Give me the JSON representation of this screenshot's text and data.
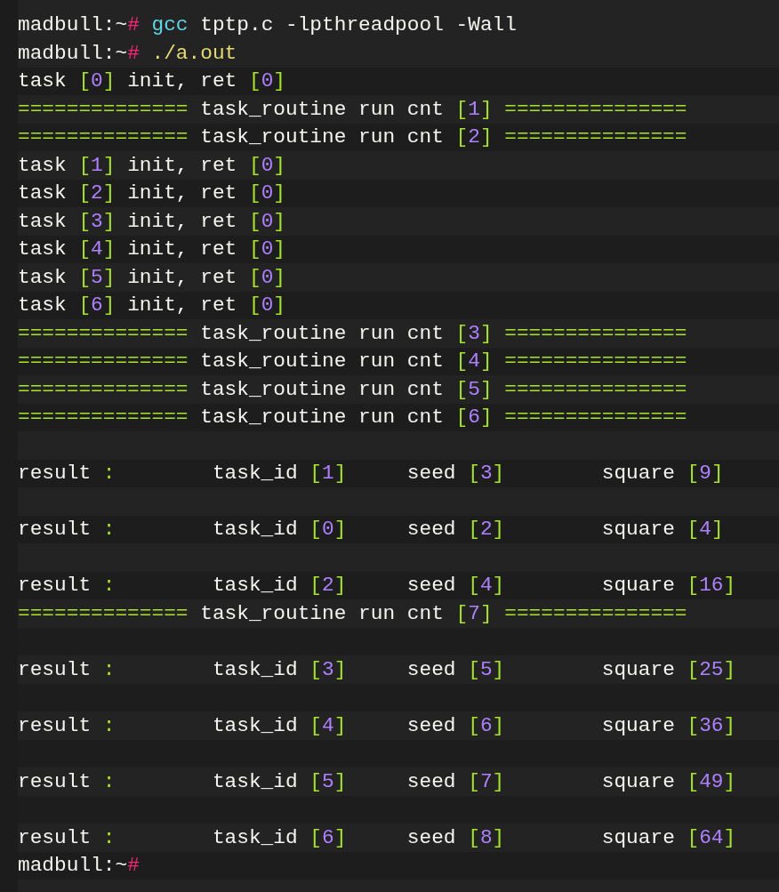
{
  "lines": [
    {
      "kind": "text",
      "segments": [
        {
          "kind": "plain",
          "text": "madbull:~"
        },
        {
          "kind": "prompt",
          "text": "# "
        },
        {
          "kind": "command",
          "text": "gcc"
        },
        {
          "kind": "plain",
          "text": " tptp.c -lpthreadpool -Wall"
        }
      ]
    },
    {
      "kind": "text",
      "segments": [
        {
          "kind": "plain",
          "text": "madbull:~"
        },
        {
          "kind": "prompt",
          "text": "# "
        },
        {
          "kind": "path",
          "text": "./a.out"
        }
      ]
    },
    {
      "kind": "text",
      "segments": [
        {
          "kind": "plain",
          "text": "task "
        },
        {
          "kind": "bracket",
          "text": "["
        },
        {
          "kind": "number",
          "text": "0"
        },
        {
          "kind": "bracket",
          "text": "]"
        },
        {
          "kind": "plain",
          "text": " init, ret "
        },
        {
          "kind": "bracket",
          "text": "["
        },
        {
          "kind": "number",
          "text": "0"
        },
        {
          "kind": "bracket",
          "text": "]"
        }
      ]
    },
    {
      "kind": "text",
      "segments": [
        {
          "kind": "rule",
          "text": "=============="
        },
        {
          "kind": "plain",
          "text": " task_routine run cnt "
        },
        {
          "kind": "bracket",
          "text": "["
        },
        {
          "kind": "number",
          "text": "1"
        },
        {
          "kind": "bracket",
          "text": "]"
        },
        {
          "kind": "rule",
          "text": " ==============="
        }
      ]
    },
    {
      "kind": "text",
      "segments": [
        {
          "kind": "rule",
          "text": "=============="
        },
        {
          "kind": "plain",
          "text": " task_routine run cnt "
        },
        {
          "kind": "bracket",
          "text": "["
        },
        {
          "kind": "number",
          "text": "2"
        },
        {
          "kind": "bracket",
          "text": "]"
        },
        {
          "kind": "rule",
          "text": " ==============="
        }
      ]
    },
    {
      "kind": "text",
      "segments": [
        {
          "kind": "plain",
          "text": "task "
        },
        {
          "kind": "bracket",
          "text": "["
        },
        {
          "kind": "number",
          "text": "1"
        },
        {
          "kind": "bracket",
          "text": "]"
        },
        {
          "kind": "plain",
          "text": " init, ret "
        },
        {
          "kind": "bracket",
          "text": "["
        },
        {
          "kind": "number",
          "text": "0"
        },
        {
          "kind": "bracket",
          "text": "]"
        }
      ]
    },
    {
      "kind": "text",
      "segments": [
        {
          "kind": "plain",
          "text": "task "
        },
        {
          "kind": "bracket",
          "text": "["
        },
        {
          "kind": "number",
          "text": "2"
        },
        {
          "kind": "bracket",
          "text": "]"
        },
        {
          "kind": "plain",
          "text": " init, ret "
        },
        {
          "kind": "bracket",
          "text": "["
        },
        {
          "kind": "number",
          "text": "0"
        },
        {
          "kind": "bracket",
          "text": "]"
        }
      ]
    },
    {
      "kind": "text",
      "segments": [
        {
          "kind": "plain",
          "text": "task "
        },
        {
          "kind": "bracket",
          "text": "["
        },
        {
          "kind": "number",
          "text": "3"
        },
        {
          "kind": "bracket",
          "text": "]"
        },
        {
          "kind": "plain",
          "text": " init, ret "
        },
        {
          "kind": "bracket",
          "text": "["
        },
        {
          "kind": "number",
          "text": "0"
        },
        {
          "kind": "bracket",
          "text": "]"
        }
      ]
    },
    {
      "kind": "text",
      "segments": [
        {
          "kind": "plain",
          "text": "task "
        },
        {
          "kind": "bracket",
          "text": "["
        },
        {
          "kind": "number",
          "text": "4"
        },
        {
          "kind": "bracket",
          "text": "]"
        },
        {
          "kind": "plain",
          "text": " init, ret "
        },
        {
          "kind": "bracket",
          "text": "["
        },
        {
          "kind": "number",
          "text": "0"
        },
        {
          "kind": "bracket",
          "text": "]"
        }
      ]
    },
    {
      "kind": "text",
      "segments": [
        {
          "kind": "plain",
          "text": "task "
        },
        {
          "kind": "bracket",
          "text": "["
        },
        {
          "kind": "number",
          "text": "5"
        },
        {
          "kind": "bracket",
          "text": "]"
        },
        {
          "kind": "plain",
          "text": " init, ret "
        },
        {
          "kind": "bracket",
          "text": "["
        },
        {
          "kind": "number",
          "text": "0"
        },
        {
          "kind": "bracket",
          "text": "]"
        }
      ]
    },
    {
      "kind": "text",
      "segments": [
        {
          "kind": "plain",
          "text": "task "
        },
        {
          "kind": "bracket",
          "text": "["
        },
        {
          "kind": "number",
          "text": "6"
        },
        {
          "kind": "bracket",
          "text": "]"
        },
        {
          "kind": "plain",
          "text": " init, ret "
        },
        {
          "kind": "bracket",
          "text": "["
        },
        {
          "kind": "number",
          "text": "0"
        },
        {
          "kind": "bracket",
          "text": "]"
        }
      ]
    },
    {
      "kind": "text",
      "segments": [
        {
          "kind": "rule",
          "text": "=============="
        },
        {
          "kind": "plain",
          "text": " task_routine run cnt "
        },
        {
          "kind": "bracket",
          "text": "["
        },
        {
          "kind": "number",
          "text": "3"
        },
        {
          "kind": "bracket",
          "text": "]"
        },
        {
          "kind": "rule",
          "text": " ==============="
        }
      ]
    },
    {
      "kind": "text",
      "segments": [
        {
          "kind": "rule",
          "text": "=============="
        },
        {
          "kind": "plain",
          "text": " task_routine run cnt "
        },
        {
          "kind": "bracket",
          "text": "["
        },
        {
          "kind": "number",
          "text": "4"
        },
        {
          "kind": "bracket",
          "text": "]"
        },
        {
          "kind": "rule",
          "text": " ==============="
        }
      ]
    },
    {
      "kind": "text",
      "segments": [
        {
          "kind": "rule",
          "text": "=============="
        },
        {
          "kind": "plain",
          "text": " task_routine run cnt "
        },
        {
          "kind": "bracket",
          "text": "["
        },
        {
          "kind": "number",
          "text": "5"
        },
        {
          "kind": "bracket",
          "text": "]"
        },
        {
          "kind": "rule",
          "text": " ==============="
        }
      ]
    },
    {
      "kind": "text",
      "segments": [
        {
          "kind": "rule",
          "text": "=============="
        },
        {
          "kind": "plain",
          "text": " task_routine run cnt "
        },
        {
          "kind": "bracket",
          "text": "["
        },
        {
          "kind": "number",
          "text": "6"
        },
        {
          "kind": "bracket",
          "text": "]"
        },
        {
          "kind": "rule",
          "text": " ==============="
        }
      ]
    },
    {
      "kind": "blank"
    },
    {
      "kind": "text",
      "segments": [
        {
          "kind": "plain",
          "text": "result "
        },
        {
          "kind": "colon",
          "text": ":"
        },
        {
          "kind": "plain",
          "text": "        task_id "
        },
        {
          "kind": "bracket",
          "text": "["
        },
        {
          "kind": "number",
          "text": "1"
        },
        {
          "kind": "bracket",
          "text": "]"
        },
        {
          "kind": "plain",
          "text": "     seed "
        },
        {
          "kind": "bracket",
          "text": "["
        },
        {
          "kind": "number",
          "text": "3"
        },
        {
          "kind": "bracket",
          "text": "]"
        },
        {
          "kind": "plain",
          "text": "        square "
        },
        {
          "kind": "bracket",
          "text": "["
        },
        {
          "kind": "number",
          "text": "9"
        },
        {
          "kind": "bracket",
          "text": "]"
        }
      ]
    },
    {
      "kind": "blank"
    },
    {
      "kind": "text",
      "segments": [
        {
          "kind": "plain",
          "text": "result "
        },
        {
          "kind": "colon",
          "text": ":"
        },
        {
          "kind": "plain",
          "text": "        task_id "
        },
        {
          "kind": "bracket",
          "text": "["
        },
        {
          "kind": "number",
          "text": "0"
        },
        {
          "kind": "bracket",
          "text": "]"
        },
        {
          "kind": "plain",
          "text": "     seed "
        },
        {
          "kind": "bracket",
          "text": "["
        },
        {
          "kind": "number",
          "text": "2"
        },
        {
          "kind": "bracket",
          "text": "]"
        },
        {
          "kind": "plain",
          "text": "        square "
        },
        {
          "kind": "bracket",
          "text": "["
        },
        {
          "kind": "number",
          "text": "4"
        },
        {
          "kind": "bracket",
          "text": "]"
        }
      ]
    },
    {
      "kind": "blank"
    },
    {
      "kind": "text",
      "segments": [
        {
          "kind": "plain",
          "text": "result "
        },
        {
          "kind": "colon",
          "text": ":"
        },
        {
          "kind": "plain",
          "text": "        task_id "
        },
        {
          "kind": "bracket",
          "text": "["
        },
        {
          "kind": "number",
          "text": "2"
        },
        {
          "kind": "bracket",
          "text": "]"
        },
        {
          "kind": "plain",
          "text": "     seed "
        },
        {
          "kind": "bracket",
          "text": "["
        },
        {
          "kind": "number",
          "text": "4"
        },
        {
          "kind": "bracket",
          "text": "]"
        },
        {
          "kind": "plain",
          "text": "        square "
        },
        {
          "kind": "bracket",
          "text": "["
        },
        {
          "kind": "number",
          "text": "16"
        },
        {
          "kind": "bracket",
          "text": "]"
        }
      ]
    },
    {
      "kind": "text",
      "segments": [
        {
          "kind": "rule",
          "text": "=============="
        },
        {
          "kind": "plain",
          "text": " task_routine run cnt "
        },
        {
          "kind": "bracket",
          "text": "["
        },
        {
          "kind": "number",
          "text": "7"
        },
        {
          "kind": "bracket",
          "text": "]"
        },
        {
          "kind": "rule",
          "text": " ==============="
        }
      ]
    },
    {
      "kind": "blank"
    },
    {
      "kind": "text",
      "segments": [
        {
          "kind": "plain",
          "text": "result "
        },
        {
          "kind": "colon",
          "text": ":"
        },
        {
          "kind": "plain",
          "text": "        task_id "
        },
        {
          "kind": "bracket",
          "text": "["
        },
        {
          "kind": "number",
          "text": "3"
        },
        {
          "kind": "bracket",
          "text": "]"
        },
        {
          "kind": "plain",
          "text": "     seed "
        },
        {
          "kind": "bracket",
          "text": "["
        },
        {
          "kind": "number",
          "text": "5"
        },
        {
          "kind": "bracket",
          "text": "]"
        },
        {
          "kind": "plain",
          "text": "        square "
        },
        {
          "kind": "bracket",
          "text": "["
        },
        {
          "kind": "number",
          "text": "25"
        },
        {
          "kind": "bracket",
          "text": "]"
        }
      ]
    },
    {
      "kind": "blank"
    },
    {
      "kind": "text",
      "segments": [
        {
          "kind": "plain",
          "text": "result "
        },
        {
          "kind": "colon",
          "text": ":"
        },
        {
          "kind": "plain",
          "text": "        task_id "
        },
        {
          "kind": "bracket",
          "text": "["
        },
        {
          "kind": "number",
          "text": "4"
        },
        {
          "kind": "bracket",
          "text": "]"
        },
        {
          "kind": "plain",
          "text": "     seed "
        },
        {
          "kind": "bracket",
          "text": "["
        },
        {
          "kind": "number",
          "text": "6"
        },
        {
          "kind": "bracket",
          "text": "]"
        },
        {
          "kind": "plain",
          "text": "        square "
        },
        {
          "kind": "bracket",
          "text": "["
        },
        {
          "kind": "number",
          "text": "36"
        },
        {
          "kind": "bracket",
          "text": "]"
        }
      ]
    },
    {
      "kind": "blank"
    },
    {
      "kind": "text",
      "segments": [
        {
          "kind": "plain",
          "text": "result "
        },
        {
          "kind": "colon",
          "text": ":"
        },
        {
          "kind": "plain",
          "text": "        task_id "
        },
        {
          "kind": "bracket",
          "text": "["
        },
        {
          "kind": "number",
          "text": "5"
        },
        {
          "kind": "bracket",
          "text": "]"
        },
        {
          "kind": "plain",
          "text": "     seed "
        },
        {
          "kind": "bracket",
          "text": "["
        },
        {
          "kind": "number",
          "text": "7"
        },
        {
          "kind": "bracket",
          "text": "]"
        },
        {
          "kind": "plain",
          "text": "        square "
        },
        {
          "kind": "bracket",
          "text": "["
        },
        {
          "kind": "number",
          "text": "49"
        },
        {
          "kind": "bracket",
          "text": "]"
        }
      ]
    },
    {
      "kind": "blank"
    },
    {
      "kind": "text",
      "segments": [
        {
          "kind": "plain",
          "text": "result "
        },
        {
          "kind": "colon",
          "text": ":"
        },
        {
          "kind": "plain",
          "text": "        task_id "
        },
        {
          "kind": "bracket",
          "text": "["
        },
        {
          "kind": "number",
          "text": "6"
        },
        {
          "kind": "bracket",
          "text": "]"
        },
        {
          "kind": "plain",
          "text": "     seed "
        },
        {
          "kind": "bracket",
          "text": "["
        },
        {
          "kind": "number",
          "text": "8"
        },
        {
          "kind": "bracket",
          "text": "]"
        },
        {
          "kind": "plain",
          "text": "        square "
        },
        {
          "kind": "bracket",
          "text": "["
        },
        {
          "kind": "number",
          "text": "64"
        },
        {
          "kind": "bracket",
          "text": "]"
        }
      ]
    },
    {
      "kind": "text",
      "segments": [
        {
          "kind": "plain",
          "text": "madbull:~"
        },
        {
          "kind": "prompt",
          "text": "#"
        }
      ]
    }
  ]
}
